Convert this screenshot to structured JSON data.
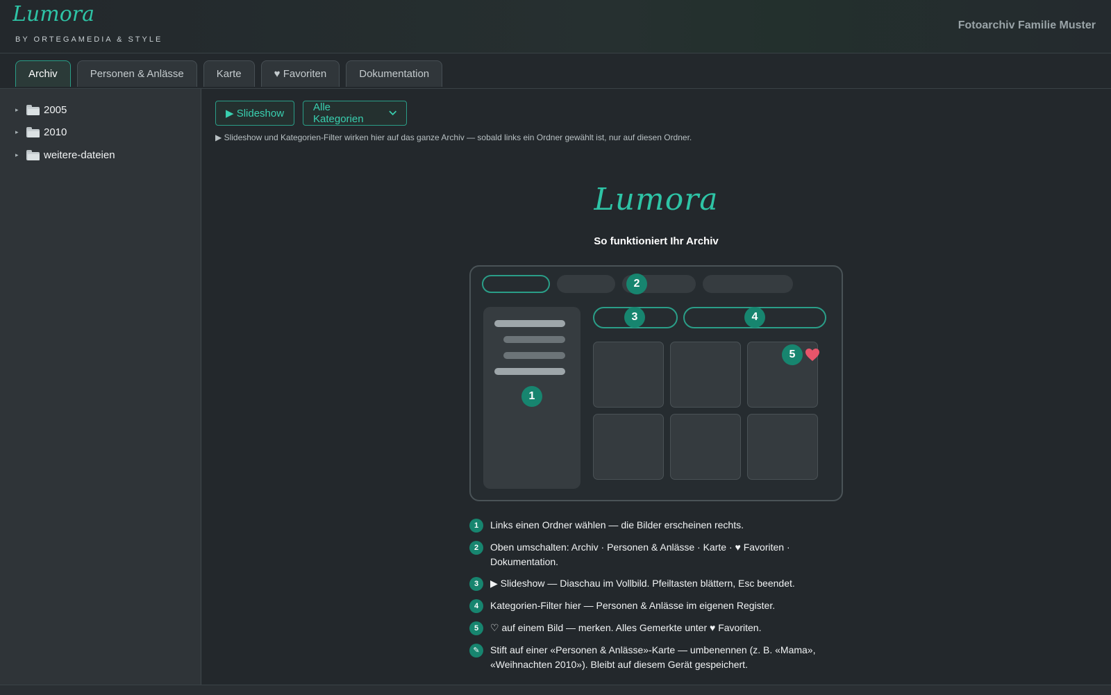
{
  "header": {
    "logo_script": "Lumora",
    "logo_sub": "BY ORTEGAMEDIA & STYLE",
    "app_title": "Fotoarchiv Familie Muster"
  },
  "tabs": [
    {
      "label": "Archiv",
      "active": true
    },
    {
      "label": "Personen & Anlässe"
    },
    {
      "label": "Karte"
    },
    {
      "label": "♥ Favoriten",
      "icon": "heart-icon"
    },
    {
      "label": "Dokumentation"
    }
  ],
  "sidebar": {
    "folders": [
      {
        "label": "2005",
        "icon": "folder-icon"
      },
      {
        "label": "2010",
        "icon": "folder-icon"
      },
      {
        "label": "weitere-dateien",
        "icon": "folder-icon"
      }
    ]
  },
  "toolbar": {
    "slideshow_label": "▶ Slideshow",
    "category_select": "Alle Kategorien",
    "hint": "▶ Slideshow und Kategorien-Filter wirken hier auf das ganze Archiv — sobald links ein Ordner gewählt ist, nur auf diesen Ordner."
  },
  "intro": {
    "brand": "Lumora",
    "title": "So funktioniert Ihr Archiv",
    "markers": [
      "1",
      "2",
      "3",
      "4",
      "5"
    ]
  },
  "steps": [
    {
      "marker": "1",
      "text": "Links einen Ordner wählen — die Bilder erscheinen rechts."
    },
    {
      "marker": "2",
      "text": "Oben umschalten: Archiv · Personen & Anlässe · Karte · ♥ Favoriten · Dokumentation."
    },
    {
      "marker": "3",
      "text": "▶ Slideshow — Diaschau im Vollbild. Pfeiltasten blättern, Esc beendet."
    },
    {
      "marker": "4",
      "text": "Kategorien-Filter hier — Personen & Anlässe im eigenen Register."
    },
    {
      "marker": "5",
      "text": "♡ auf einem Bild — merken. Alles Gemerkte unter ♥ Favoriten."
    },
    {
      "marker": "✎",
      "text": "Stift auf einer «Personen & Anlässe»-Karte — umbenennen (z. B. «Mama», «Weihnachten 2010»). Bleibt auf diesem Gerät gespeichert."
    }
  ],
  "colors": {
    "accent": "#2ec4a6",
    "accent_dark": "#17856f",
    "heart": "#e8556a",
    "background": "#23282c"
  }
}
